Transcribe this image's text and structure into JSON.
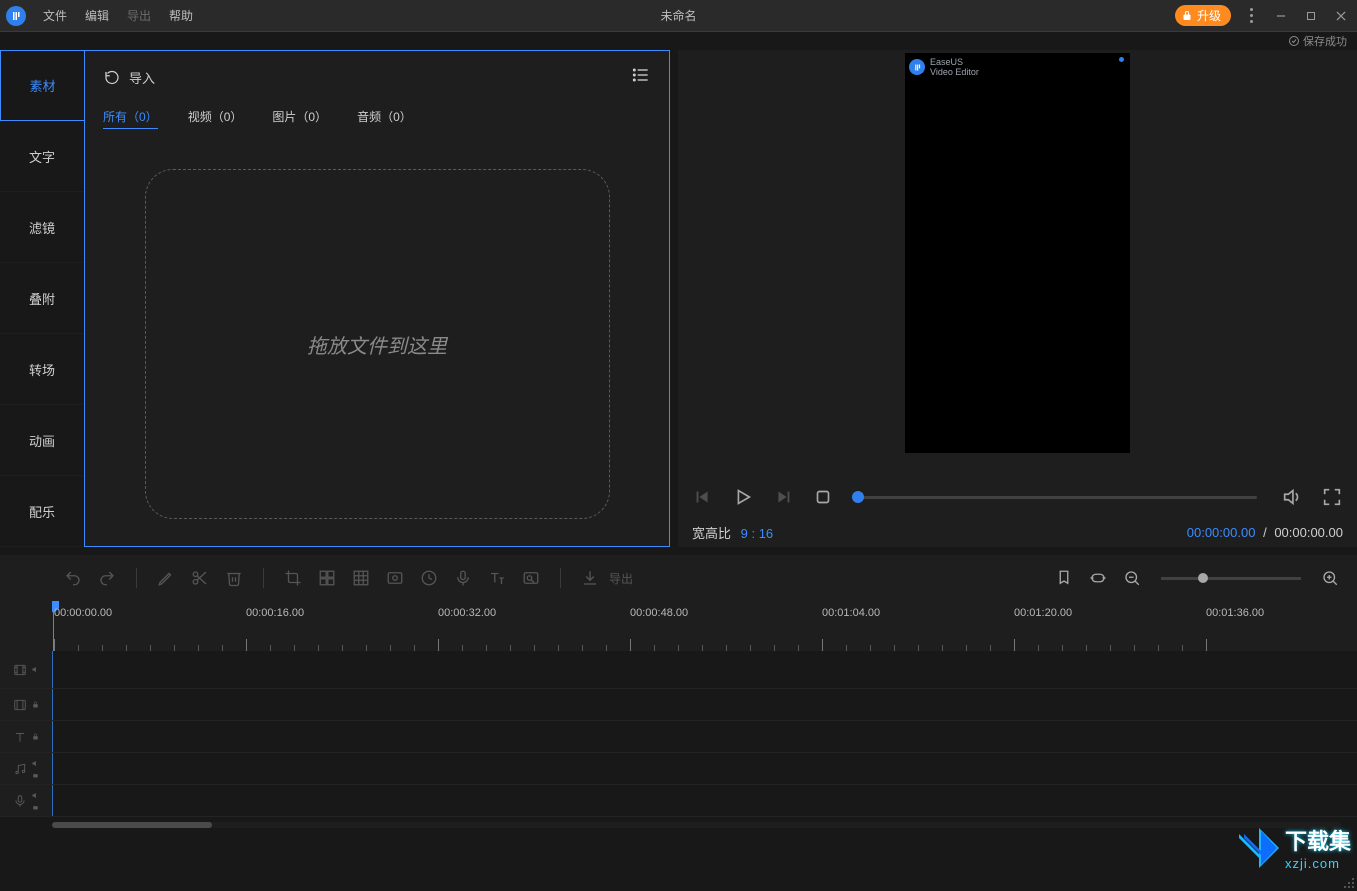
{
  "menu": {
    "file": "文件",
    "edit": "编辑",
    "export": "导出",
    "help": "帮助"
  },
  "window_title": "未命名",
  "upgrade": "升级",
  "save_status": "保存成功",
  "sidebar": {
    "material": "素材",
    "text": "文字",
    "filter": "滤镜",
    "overlay": "叠附",
    "transition": "转场",
    "motion": "动画",
    "music": "配乐"
  },
  "media": {
    "import": "导入",
    "tabs": {
      "all": "所有（0）",
      "video": "视频（0）",
      "image": "图片（0）",
      "audio": "音频（0）"
    },
    "drop_hint": "拖放文件到这里"
  },
  "preview": {
    "brand_line1": "EaseUS",
    "brand_line2": "Video Editor",
    "aspect_label": "宽高比",
    "aspect_value": "9 : 16",
    "cur_time": "00:00:00.00",
    "dur_time": "00:00:00.00"
  },
  "toolbar": {
    "export": "导出"
  },
  "timeline": {
    "labels": [
      "00:00:00.00",
      "00:00:16.00",
      "00:00:32.00",
      "00:00:48.00",
      "00:01:04.00",
      "00:01:20.00",
      "00:01:36.00"
    ]
  },
  "watermark": {
    "name": "下载集",
    "url": "xzji.com"
  }
}
